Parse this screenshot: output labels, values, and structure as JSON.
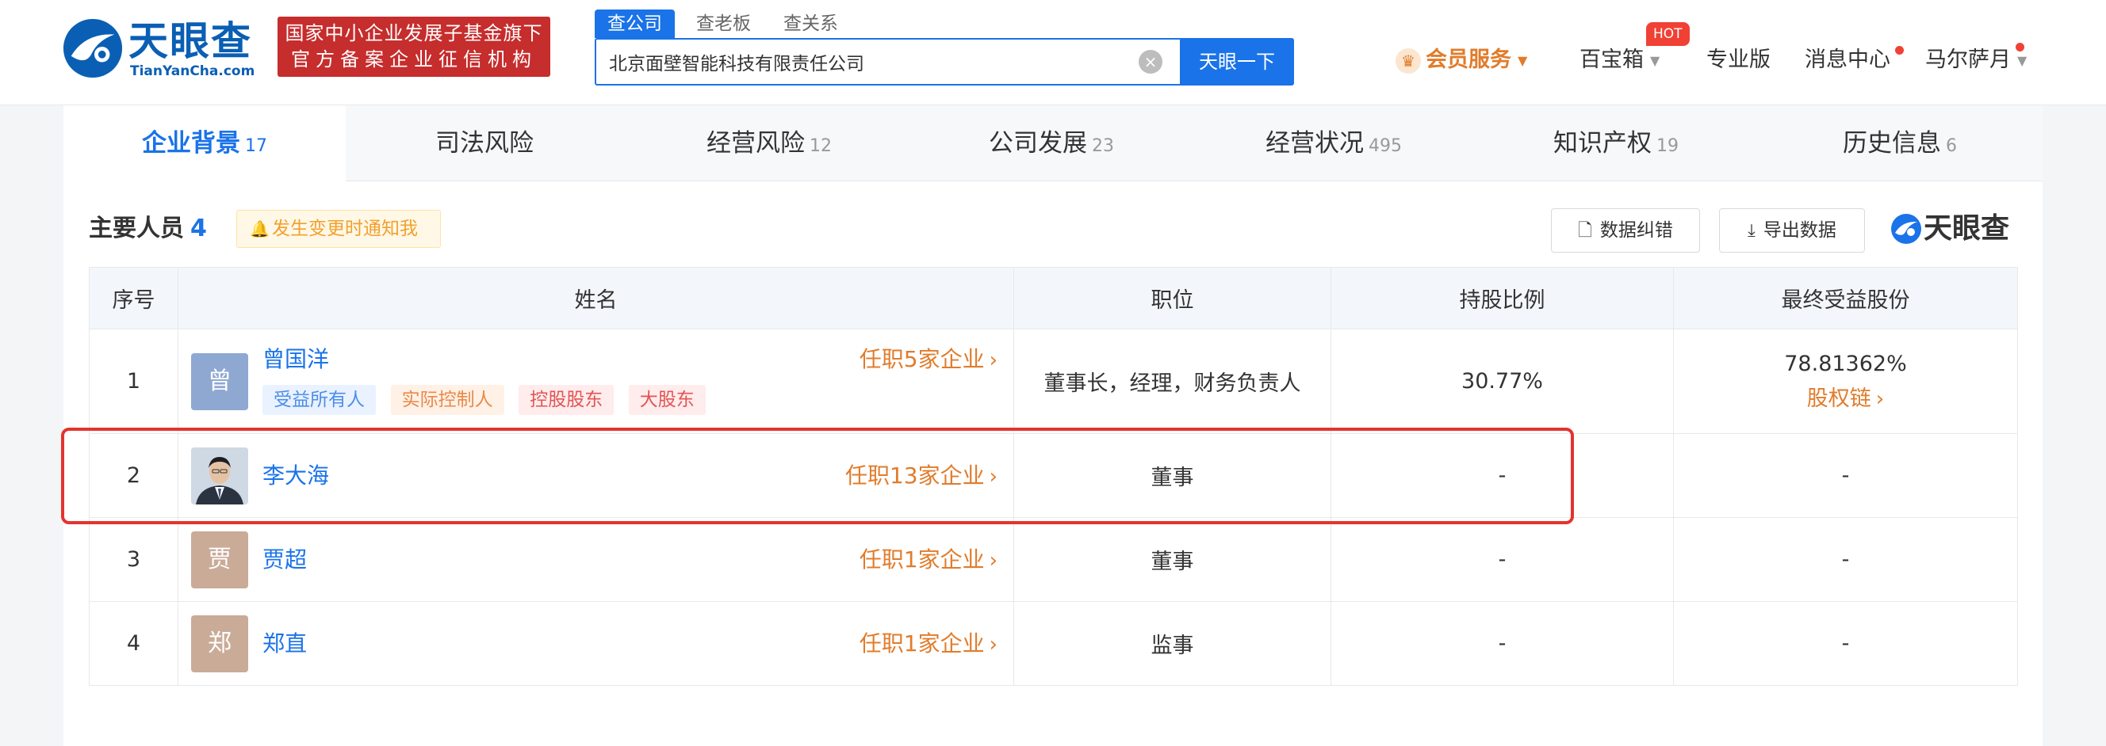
{
  "header": {
    "logo_cn": "天眼查",
    "logo_en": "TianYanCha.com",
    "slogan_line1": "国家中小企业发展子基金旗下",
    "slogan_line2": "官方备案企业征信机构",
    "search_tabs": [
      "查公司",
      "查老板",
      "查关系"
    ],
    "search_value": "北京面壁智能科技有限责任公司",
    "search_button": "天眼一下",
    "nav": {
      "vip": "会员服务",
      "baobao": "百宝箱",
      "hot": "HOT",
      "pro": "专业版",
      "messages": "消息中心",
      "user": "马尔萨月"
    }
  },
  "tabs": [
    {
      "label": "企业背景",
      "count": "17"
    },
    {
      "label": "司法风险",
      "count": ""
    },
    {
      "label": "经营风险",
      "count": "12"
    },
    {
      "label": "公司发展",
      "count": "23"
    },
    {
      "label": "经营状况",
      "count": "495"
    },
    {
      "label": "知识产权",
      "count": "19"
    },
    {
      "label": "历史信息",
      "count": "6"
    }
  ],
  "section": {
    "title": "主要人员",
    "count": "4",
    "notify": "发生变更时通知我",
    "correct_btn": "数据纠错",
    "export_btn": "导出数据",
    "brand": "天眼查"
  },
  "table": {
    "headers": [
      "序号",
      "姓名",
      "职位",
      "持股比例",
      "最终受益股份"
    ],
    "rows": [
      {
        "no": "1",
        "avatar_char": "曾",
        "name": "曾国洋",
        "jobs": "任职5家企业",
        "tags": [
          "受益所有人",
          "实际控制人",
          "控股股东",
          "大股东"
        ],
        "position": "董事长，经理，财务负责人",
        "share": "30.77%",
        "benefit": "78.81362%",
        "benefit_link": "股权链"
      },
      {
        "no": "2",
        "name": "李大海",
        "jobs": "任职13家企业",
        "position": "董事",
        "share": "-",
        "benefit": "-"
      },
      {
        "no": "3",
        "avatar_char": "贾",
        "name": "贾超",
        "jobs": "任职1家企业",
        "position": "董事",
        "share": "-",
        "benefit": "-"
      },
      {
        "no": "4",
        "avatar_char": "郑",
        "name": "郑直",
        "jobs": "任职1家企业",
        "position": "监事",
        "share": "-",
        "benefit": "-"
      }
    ]
  },
  "colors": {
    "brand_blue": "#1a73e8",
    "orange": "#e17c2b",
    "highlight_red": "#e3342f"
  }
}
